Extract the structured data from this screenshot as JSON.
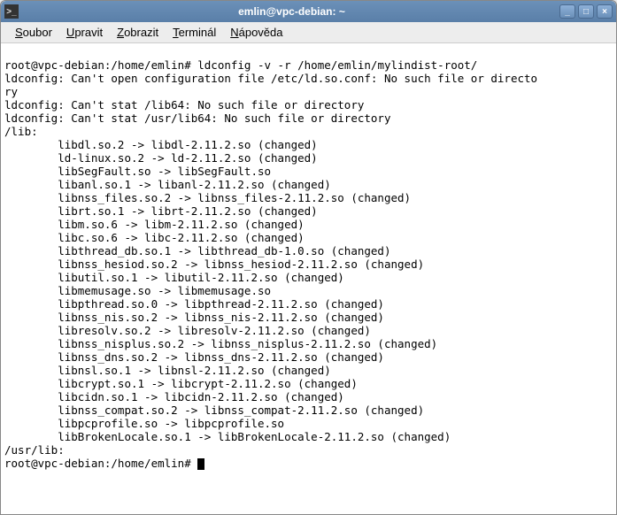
{
  "window": {
    "title": "emlin@vpc-debian: ~"
  },
  "menubar": {
    "items": [
      {
        "label": "Soubor",
        "ul": "S"
      },
      {
        "label": "Upravit",
        "ul": "U"
      },
      {
        "label": "Zobrazit",
        "ul": "Z"
      },
      {
        "label": "Terminál",
        "ul": "T"
      },
      {
        "label": "Nápověda",
        "ul": "N"
      }
    ]
  },
  "terminal": {
    "prompt1": "root@vpc-debian:/home/emlin# ",
    "command1": "ldconfig -v -r /home/emlin/mylindist-root/",
    "lines": [
      "ldconfig: Can't open configuration file /etc/ld.so.conf: No such file or directo",
      "ry",
      "ldconfig: Can't stat /lib64: No such file or directory",
      "ldconfig: Can't stat /usr/lib64: No such file or directory",
      "/lib:",
      "        libdl.so.2 -> libdl-2.11.2.so (changed)",
      "        ld-linux.so.2 -> ld-2.11.2.so (changed)",
      "        libSegFault.so -> libSegFault.so",
      "        libanl.so.1 -> libanl-2.11.2.so (changed)",
      "        libnss_files.so.2 -> libnss_files-2.11.2.so (changed)",
      "        librt.so.1 -> librt-2.11.2.so (changed)",
      "        libm.so.6 -> libm-2.11.2.so (changed)",
      "        libc.so.6 -> libc-2.11.2.so (changed)",
      "        libthread_db.so.1 -> libthread_db-1.0.so (changed)",
      "        libnss_hesiod.so.2 -> libnss_hesiod-2.11.2.so (changed)",
      "        libutil.so.1 -> libutil-2.11.2.so (changed)",
      "        libmemusage.so -> libmemusage.so",
      "        libpthread.so.0 -> libpthread-2.11.2.so (changed)",
      "        libnss_nis.so.2 -> libnss_nis-2.11.2.so (changed)",
      "        libresolv.so.2 -> libresolv-2.11.2.so (changed)",
      "        libnss_nisplus.so.2 -> libnss_nisplus-2.11.2.so (changed)",
      "        libnss_dns.so.2 -> libnss_dns-2.11.2.so (changed)",
      "        libnsl.so.1 -> libnsl-2.11.2.so (changed)",
      "        libcrypt.so.1 -> libcrypt-2.11.2.so (changed)",
      "        libcidn.so.1 -> libcidn-2.11.2.so (changed)",
      "        libnss_compat.so.2 -> libnss_compat-2.11.2.so (changed)",
      "        libpcprofile.so -> libpcprofile.so",
      "        libBrokenLocale.so.1 -> libBrokenLocale-2.11.2.so (changed)",
      "/usr/lib:"
    ],
    "prompt2": "root@vpc-debian:/home/emlin# "
  }
}
